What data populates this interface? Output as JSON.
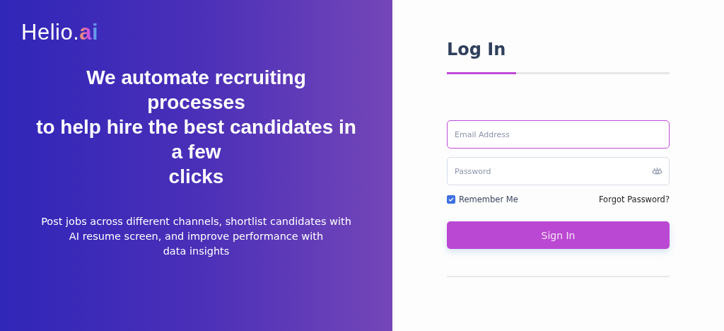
{
  "brand": {
    "name": "Helio.",
    "suffix": "ai"
  },
  "headline": [
    "We automate recruiting",
    "processes",
    "to help hire the best candidates in",
    "a few",
    "clicks"
  ],
  "description": [
    "Post jobs across different channels, shortlist candidates with",
    "AI resume screen, and improve performance with",
    "data insights"
  ],
  "login": {
    "title": "Log In",
    "progress": {
      "level": 0.31
    },
    "email": {
      "placeholder": "Email Address",
      "focused": true
    },
    "password": {
      "placeholder": "Password"
    },
    "remember": {
      "label": "Remember Me",
      "checked": true
    },
    "forgot": "Forgot Password?",
    "submit": "Sign In"
  }
}
